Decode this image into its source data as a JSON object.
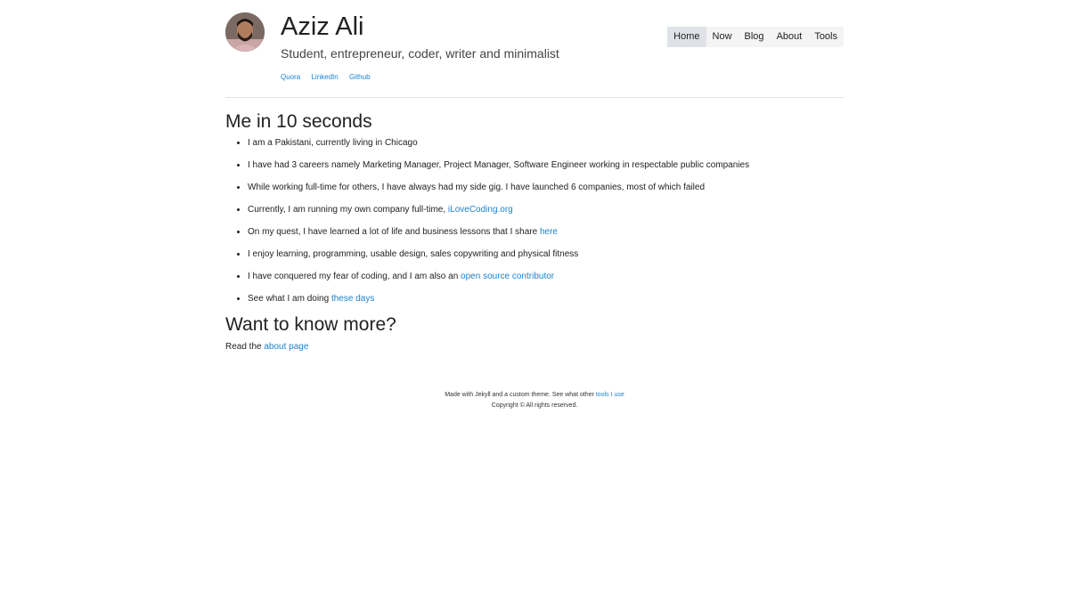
{
  "header": {
    "name": "Aziz Ali",
    "tagline": "Student, entrepreneur, coder, writer and minimalist",
    "social_links": [
      "Quora",
      "LinkedIn",
      "Github"
    ]
  },
  "nav": {
    "items": [
      "Home",
      "Now",
      "Blog",
      "About",
      "Tools"
    ],
    "active": "Home"
  },
  "intro": {
    "heading": "Me in 10 seconds",
    "facts": [
      {
        "text": "I am a Pakistani, currently living in Chicago",
        "link": ""
      },
      {
        "text": "I have had 3 careers namely Marketing Manager, Project Manager, Software Engineer working in respectable public companies",
        "link": ""
      },
      {
        "text": "While working full-time for others, I have always had my side gig. I have launched 6 companies, most of which failed",
        "link": ""
      },
      {
        "text": "Currently, I am running my own company full-time, ",
        "link": "iLoveCoding.org"
      },
      {
        "text": "On my quest, I have learned a lot of life and business lessons that I share ",
        "link": "here"
      },
      {
        "text": "I enjoy learning, programming, usable design, sales copywriting and physical fitness",
        "link": ""
      },
      {
        "text": "I have conquered my fear of coding, and I am also an ",
        "link": "open source contributor"
      },
      {
        "text": "See what I am doing ",
        "link": "these days"
      }
    ]
  },
  "more": {
    "heading": "Want to know more?",
    "text": "Read the ",
    "link": "about page"
  },
  "footer": {
    "line1_text": "Made with Jekyll and a custom theme. See what other ",
    "line1_link": "tools I use",
    "line2": "Copyright © All rights reserved."
  },
  "colors": {
    "link": "#1a83d1",
    "nav_active_bg": "#dfe3e8",
    "nav_bg": "#f4f4f4"
  }
}
